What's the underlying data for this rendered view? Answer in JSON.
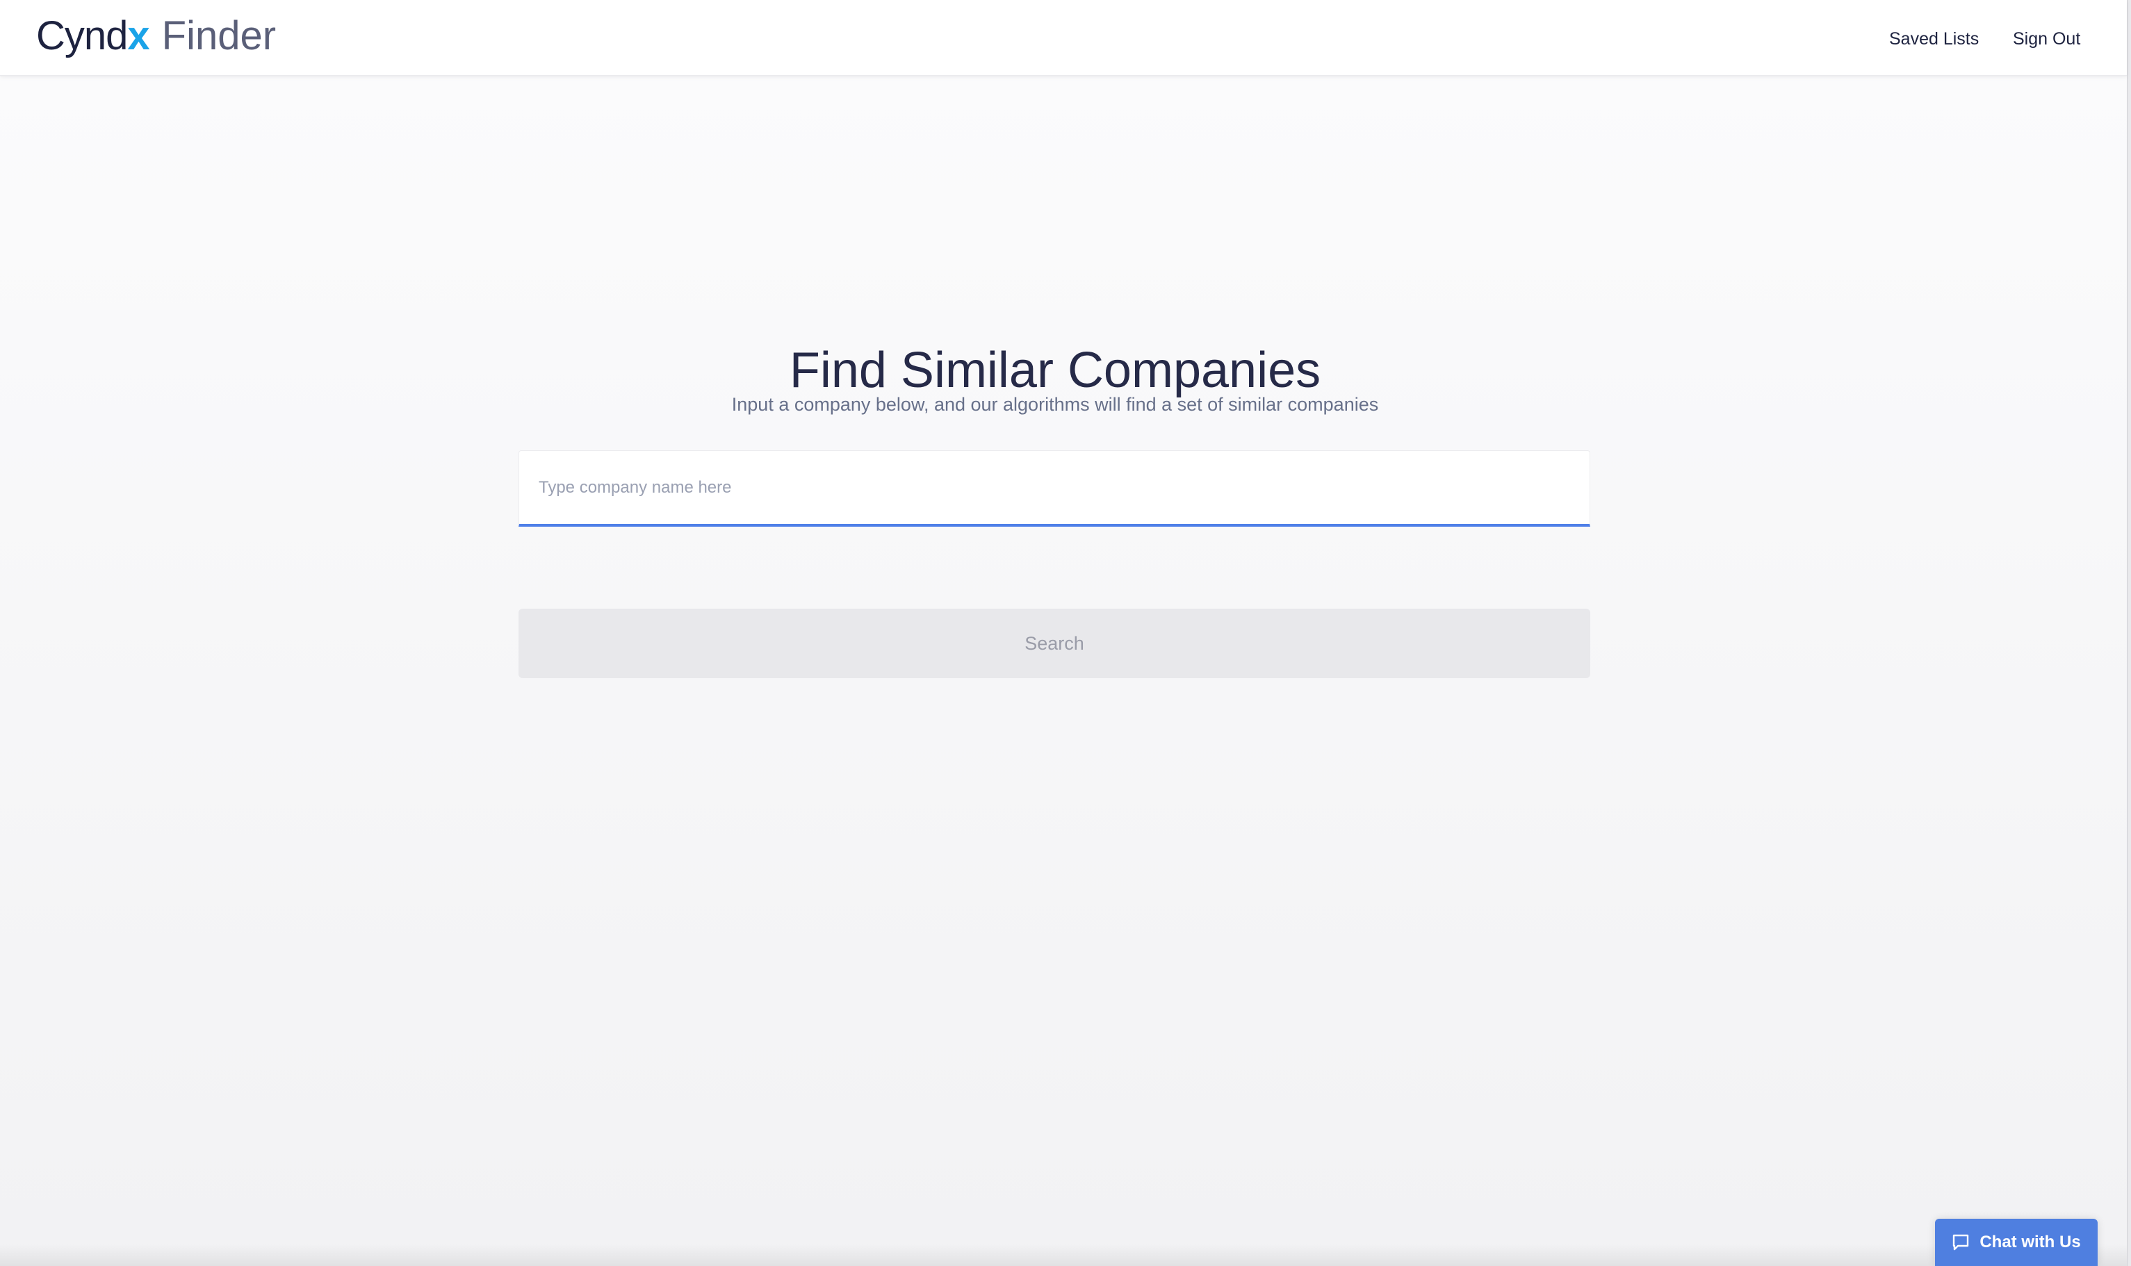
{
  "header": {
    "logo": {
      "brand_main": "Cynd",
      "brand_accent": "x",
      "product": "Finder"
    },
    "nav": {
      "saved_lists": "Saved Lists",
      "sign_out": "Sign Out"
    }
  },
  "main": {
    "title": "Find Similar Companies",
    "subtitle": "Input a company below, and our algorithms will find a set of similar companies",
    "search_input": {
      "placeholder": "Type company name here",
      "value": ""
    },
    "search_button": "Search"
  },
  "chat": {
    "label": "Chat with Us",
    "icon": "chat-bubble-icon"
  },
  "colors": {
    "brand_dark": "#1e2340",
    "brand_accent": "#1aa3e8",
    "input_focus": "#4f7fe8",
    "chat_button": "#4f7fe0"
  }
}
